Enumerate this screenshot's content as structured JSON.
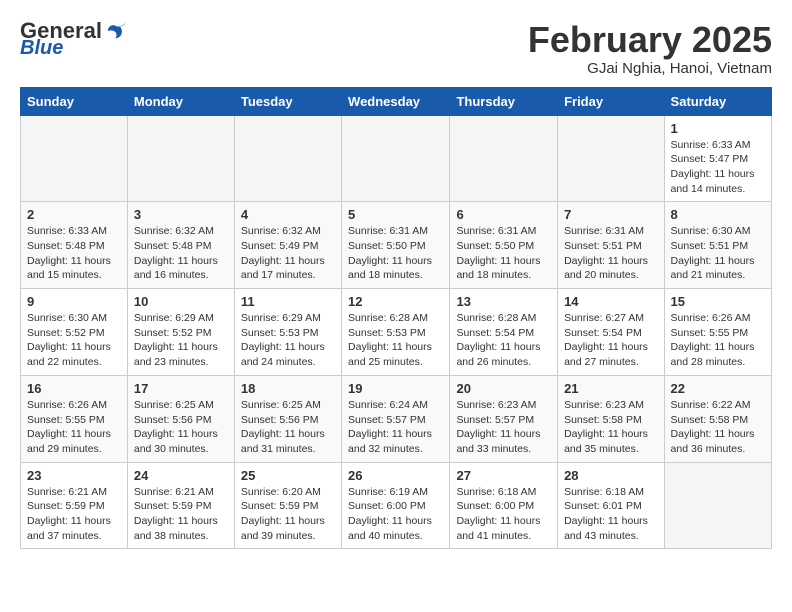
{
  "header": {
    "logo_general": "General",
    "logo_blue": "Blue",
    "month_title": "February 2025",
    "location": "GJai Nghia, Hanoi, Vietnam"
  },
  "days_of_week": [
    "Sunday",
    "Monday",
    "Tuesday",
    "Wednesday",
    "Thursday",
    "Friday",
    "Saturday"
  ],
  "weeks": [
    [
      {
        "day": "",
        "info": ""
      },
      {
        "day": "",
        "info": ""
      },
      {
        "day": "",
        "info": ""
      },
      {
        "day": "",
        "info": ""
      },
      {
        "day": "",
        "info": ""
      },
      {
        "day": "",
        "info": ""
      },
      {
        "day": "1",
        "info": "Sunrise: 6:33 AM\nSunset: 5:47 PM\nDaylight: 11 hours and 14 minutes."
      }
    ],
    [
      {
        "day": "2",
        "info": "Sunrise: 6:33 AM\nSunset: 5:48 PM\nDaylight: 11 hours and 15 minutes."
      },
      {
        "day": "3",
        "info": "Sunrise: 6:32 AM\nSunset: 5:48 PM\nDaylight: 11 hours and 16 minutes."
      },
      {
        "day": "4",
        "info": "Sunrise: 6:32 AM\nSunset: 5:49 PM\nDaylight: 11 hours and 17 minutes."
      },
      {
        "day": "5",
        "info": "Sunrise: 6:31 AM\nSunset: 5:50 PM\nDaylight: 11 hours and 18 minutes."
      },
      {
        "day": "6",
        "info": "Sunrise: 6:31 AM\nSunset: 5:50 PM\nDaylight: 11 hours and 18 minutes."
      },
      {
        "day": "7",
        "info": "Sunrise: 6:31 AM\nSunset: 5:51 PM\nDaylight: 11 hours and 20 minutes."
      },
      {
        "day": "8",
        "info": "Sunrise: 6:30 AM\nSunset: 5:51 PM\nDaylight: 11 hours and 21 minutes."
      }
    ],
    [
      {
        "day": "9",
        "info": "Sunrise: 6:30 AM\nSunset: 5:52 PM\nDaylight: 11 hours and 22 minutes."
      },
      {
        "day": "10",
        "info": "Sunrise: 6:29 AM\nSunset: 5:52 PM\nDaylight: 11 hours and 23 minutes."
      },
      {
        "day": "11",
        "info": "Sunrise: 6:29 AM\nSunset: 5:53 PM\nDaylight: 11 hours and 24 minutes."
      },
      {
        "day": "12",
        "info": "Sunrise: 6:28 AM\nSunset: 5:53 PM\nDaylight: 11 hours and 25 minutes."
      },
      {
        "day": "13",
        "info": "Sunrise: 6:28 AM\nSunset: 5:54 PM\nDaylight: 11 hours and 26 minutes."
      },
      {
        "day": "14",
        "info": "Sunrise: 6:27 AM\nSunset: 5:54 PM\nDaylight: 11 hours and 27 minutes."
      },
      {
        "day": "15",
        "info": "Sunrise: 6:26 AM\nSunset: 5:55 PM\nDaylight: 11 hours and 28 minutes."
      }
    ],
    [
      {
        "day": "16",
        "info": "Sunrise: 6:26 AM\nSunset: 5:55 PM\nDaylight: 11 hours and 29 minutes."
      },
      {
        "day": "17",
        "info": "Sunrise: 6:25 AM\nSunset: 5:56 PM\nDaylight: 11 hours and 30 minutes."
      },
      {
        "day": "18",
        "info": "Sunrise: 6:25 AM\nSunset: 5:56 PM\nDaylight: 11 hours and 31 minutes."
      },
      {
        "day": "19",
        "info": "Sunrise: 6:24 AM\nSunset: 5:57 PM\nDaylight: 11 hours and 32 minutes."
      },
      {
        "day": "20",
        "info": "Sunrise: 6:23 AM\nSunset: 5:57 PM\nDaylight: 11 hours and 33 minutes."
      },
      {
        "day": "21",
        "info": "Sunrise: 6:23 AM\nSunset: 5:58 PM\nDaylight: 11 hours and 35 minutes."
      },
      {
        "day": "22",
        "info": "Sunrise: 6:22 AM\nSunset: 5:58 PM\nDaylight: 11 hours and 36 minutes."
      }
    ],
    [
      {
        "day": "23",
        "info": "Sunrise: 6:21 AM\nSunset: 5:59 PM\nDaylight: 11 hours and 37 minutes."
      },
      {
        "day": "24",
        "info": "Sunrise: 6:21 AM\nSunset: 5:59 PM\nDaylight: 11 hours and 38 minutes."
      },
      {
        "day": "25",
        "info": "Sunrise: 6:20 AM\nSunset: 5:59 PM\nDaylight: 11 hours and 39 minutes."
      },
      {
        "day": "26",
        "info": "Sunrise: 6:19 AM\nSunset: 6:00 PM\nDaylight: 11 hours and 40 minutes."
      },
      {
        "day": "27",
        "info": "Sunrise: 6:18 AM\nSunset: 6:00 PM\nDaylight: 11 hours and 41 minutes."
      },
      {
        "day": "28",
        "info": "Sunrise: 6:18 AM\nSunset: 6:01 PM\nDaylight: 11 hours and 43 minutes."
      },
      {
        "day": "",
        "info": ""
      }
    ]
  ]
}
